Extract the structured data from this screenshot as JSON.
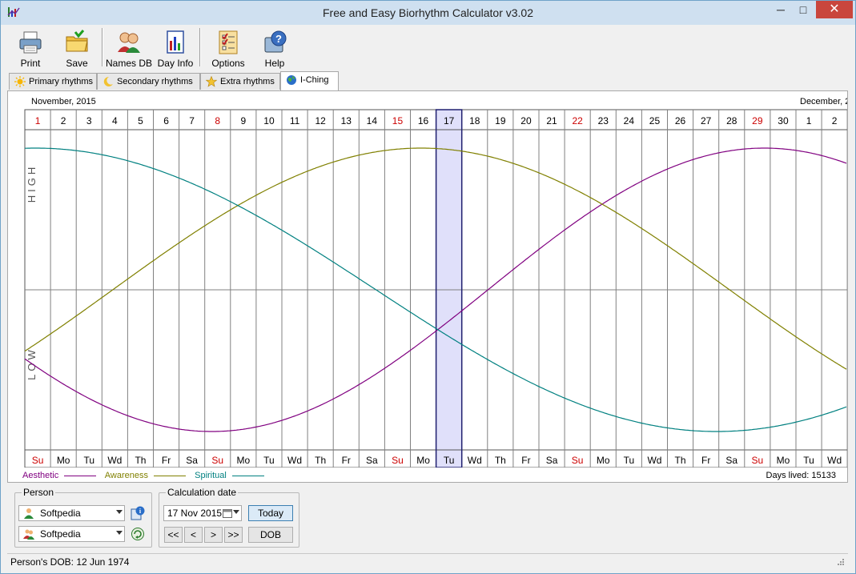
{
  "window": {
    "title": "Free and Easy Biorhythm Calculator v3.02",
    "minimize": "─",
    "maximize": "□",
    "close": "✕"
  },
  "toolbar": {
    "items": [
      {
        "label": "Print",
        "icon": "printer-icon"
      },
      {
        "label": "Save",
        "icon": "folder-icon"
      },
      {
        "label": "Names DB",
        "icon": "people-icon"
      },
      {
        "label": "Day Info",
        "icon": "day-info-icon"
      },
      {
        "label": "Options",
        "icon": "options-icon"
      },
      {
        "label": "Help",
        "icon": "help-icon"
      }
    ]
  },
  "tabs": [
    {
      "label": "Primary rhythms",
      "icon": "sun-icon",
      "active": false
    },
    {
      "label": "Secondary rhythms",
      "icon": "moon-icon",
      "active": false
    },
    {
      "label": "Extra rhythms",
      "icon": "star-icon",
      "active": false
    },
    {
      "label": "I-Ching",
      "icon": "globe-icon",
      "active": true
    }
  ],
  "chart": {
    "month_left": "November, 2015",
    "month_right": "December, 2",
    "high_label": "HIGH",
    "low_label": "LOW",
    "days_lived": "Days lived: 15133",
    "selected_day_index": 16,
    "weekend_color": "#cc0000",
    "selected_fill": "#e0e0fa",
    "selected_border": "#202070"
  },
  "chart_data": {
    "type": "line",
    "x": [
      "1",
      "2",
      "3",
      "4",
      "5",
      "6",
      "7",
      "8",
      "9",
      "10",
      "11",
      "12",
      "13",
      "14",
      "15",
      "16",
      "17",
      "18",
      "19",
      "20",
      "21",
      "22",
      "23",
      "24",
      "25",
      "26",
      "27",
      "28",
      "29",
      "30",
      "1",
      "2"
    ],
    "weekdays": [
      "Su",
      "Mo",
      "Tu",
      "Wd",
      "Th",
      "Fr",
      "Sa",
      "Su",
      "Mo",
      "Tu",
      "Wd",
      "Th",
      "Fr",
      "Sa",
      "Su",
      "Mo",
      "Tu",
      "Wd",
      "Th",
      "Fr",
      "Sa",
      "Su",
      "Mo",
      "Tu",
      "Wd",
      "Th",
      "Fr",
      "Sa",
      "Su",
      "Mo",
      "Tu",
      "Wd"
    ],
    "red_days": [
      0,
      7,
      14,
      21,
      28
    ],
    "ylim": [
      -1,
      1
    ],
    "series": [
      {
        "name": "Aesthetic",
        "color": "#800080",
        "period": 43,
        "values": [
          -0.37,
          -0.51,
          -0.63,
          -0.74,
          -0.84,
          -0.92,
          -0.97,
          -1.0,
          -1.0,
          -0.97,
          -0.92,
          -0.85,
          -0.75,
          -0.64,
          -0.51,
          -0.37,
          -0.22,
          -0.07,
          0.08,
          0.23,
          0.37,
          0.51,
          0.63,
          0.74,
          0.84,
          0.91,
          0.97,
          1.0,
          1.0,
          0.97,
          0.92,
          0.85
        ]
      },
      {
        "name": "Awareness",
        "color": "#808000",
        "period": 48,
        "values": [
          -0.37,
          -0.24,
          -0.11,
          0.02,
          0.15,
          0.28,
          0.4,
          0.51,
          0.62,
          0.71,
          0.8,
          0.87,
          0.93,
          0.97,
          0.99,
          1.0,
          0.99,
          0.96,
          0.91,
          0.85,
          0.78,
          0.69,
          0.59,
          0.48,
          0.36,
          0.24,
          0.11,
          -0.02,
          -0.15,
          -0.28,
          -0.4,
          -0.51
        ]
      },
      {
        "name": "Spiritual",
        "color": "#008080",
        "period": 53,
        "values": [
          1.0,
          1.0,
          0.99,
          0.96,
          0.92,
          0.86,
          0.79,
          0.71,
          0.62,
          0.52,
          0.4,
          0.28,
          0.16,
          0.04,
          -0.09,
          -0.21,
          -0.33,
          -0.45,
          -0.56,
          -0.66,
          -0.74,
          -0.82,
          -0.88,
          -0.93,
          -0.97,
          -0.99,
          -1.0,
          -1.0,
          -0.98,
          -0.95,
          -0.9,
          -0.84
        ]
      }
    ]
  },
  "person": {
    "group_title": "Person",
    "name1": "Softpedia",
    "name2": "Softpedia"
  },
  "calc": {
    "group_title": "Calculation date",
    "date": "17 Nov 2015",
    "today_label": "Today",
    "dob_label": "DOB",
    "first_label": "<<",
    "prev_label": "<",
    "next_label": ">",
    "last_label": ">>"
  },
  "status": {
    "dob_text": "Person's DOB: 12 Jun 1974"
  }
}
